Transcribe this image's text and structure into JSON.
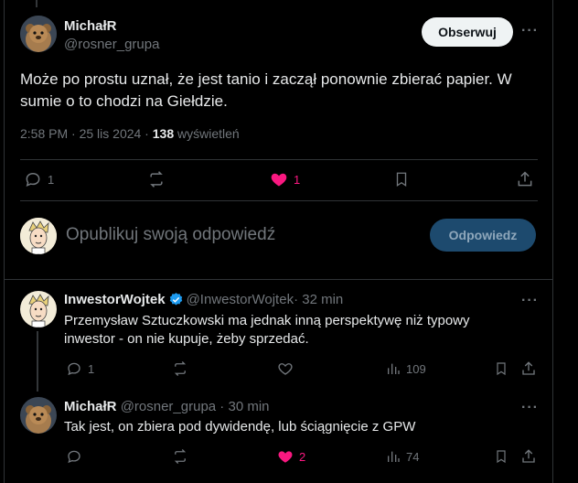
{
  "main_post": {
    "author_name": "MichałR",
    "handle": "@rosner_grupa",
    "follow_label": "Obserwuj",
    "text": "Może po prostu uznał, że jest tanio i zaczął ponownie zbierać papier. W sumie o to chodzi na Giełdzie.",
    "time": "2:58 PM · 25 lis 2024 · ",
    "views_count": "138",
    "views_label": " wyświetleń",
    "replies": "1",
    "likes": "1"
  },
  "reply_box": {
    "placeholder": "Opublikuj swoją odpowiedź",
    "button_label": "Odpowiedz"
  },
  "replies": [
    {
      "author_name": "InwestorWojtek",
      "handle": "@InwestorWojtek",
      "meta": " · 32 min",
      "text": "Przemysław Sztuczkowski ma jednak inną perspektywę niż typowy inwestor - on nie kupuje, żeby sprzedać.",
      "replies": "1",
      "likes": "",
      "views": "109"
    },
    {
      "author_name": "MichałR",
      "handle": "@rosner_grupa",
      "meta": " · 30 min",
      "text": "Tak jest, on zbiera pod dywidendę, lub ściągnięcie z GPW",
      "replies": "",
      "likes": "2",
      "views": "74"
    }
  ],
  "colors": {
    "accent": "#1d9bf0",
    "like": "#f91880",
    "muted": "#71767b"
  }
}
